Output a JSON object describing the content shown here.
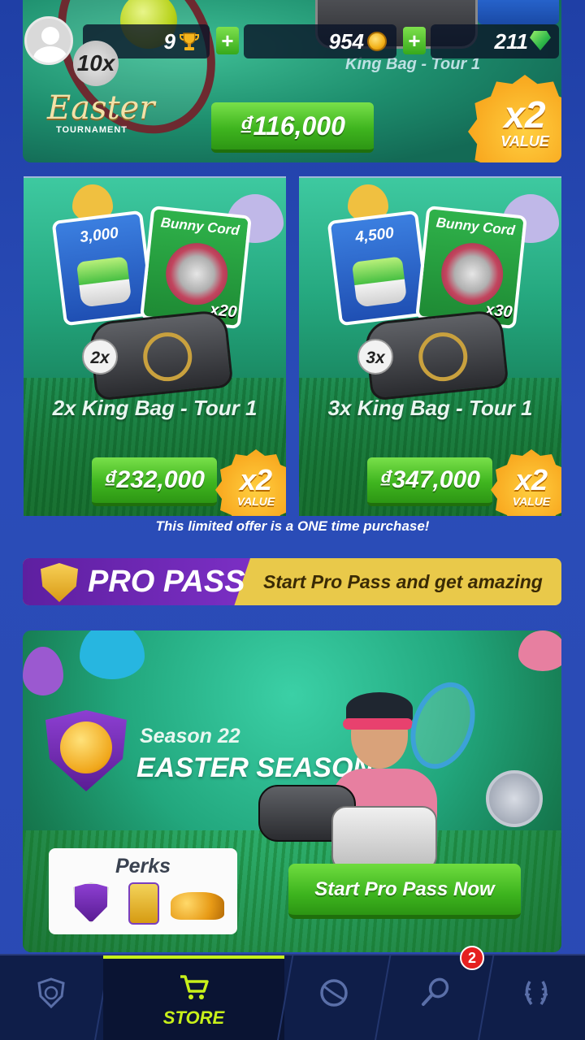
{
  "hud": {
    "trophies": "9",
    "coins": "954",
    "gems": "211",
    "player_level": "10x",
    "trophy_icon": "trophy-icon",
    "coin_icon": "coin-icon",
    "gem_icon": "gem-icon"
  },
  "hero_offer": {
    "subtitle": "King Bag - Tour 1",
    "event_logo": "Easter",
    "event_sub": "TOURNAMENT",
    "price": "₫116,000",
    "badge_mult": "x2",
    "badge_label": "VALUE"
  },
  "offers": [
    {
      "gems": "3,000",
      "cord_name": "Bunny Cord",
      "cord_mult": "x20",
      "bag_count": "2x",
      "title": "2x King Bag - Tour 1",
      "price": "₫232,000",
      "badge_mult": "x2",
      "badge_label": "VALUE"
    },
    {
      "gems": "4,500",
      "cord_name": "Bunny Cord",
      "cord_mult": "x30",
      "bag_count": "3x",
      "title": "3x King Bag - Tour 1",
      "price": "₫347,000",
      "badge_mult": "x2",
      "badge_label": "VALUE"
    }
  ],
  "limited_note": "This limited offer is a ONE time purchase!",
  "pro_pass": {
    "label": "PRO PASS",
    "tagline": "Start Pro Pass and get amazing perks!"
  },
  "season": {
    "number": "Season 22",
    "name": "EASTER SEASON",
    "perks_title": "Perks",
    "cta": "Start Pro Pass Now"
  },
  "nav": {
    "store_label": "STORE",
    "notification_count": "2",
    "tabs": [
      "club-icon",
      "cart-icon",
      "ball-icon",
      "racket-icon",
      "laurel-icon"
    ],
    "accent": "#c8f01a"
  }
}
